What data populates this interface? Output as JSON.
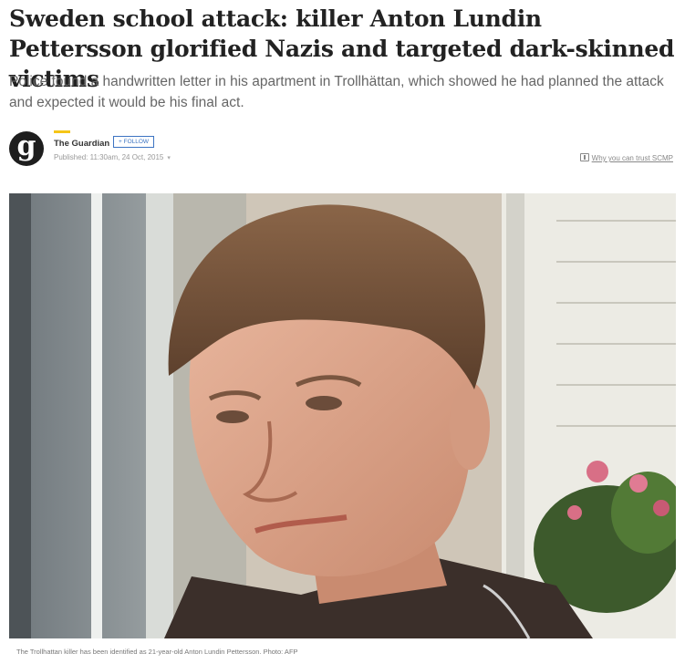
{
  "article": {
    "headline": "Sweden school attack: killer Anton Lundin Pettersson glorified Nazis and targeted dark-skinned victims",
    "standfirst": "Police found a handwritten letter in his apartment in Trollhättan, which showed he had planned the attack and expected it would be his final act."
  },
  "byline": {
    "avatar_letter": "g",
    "author": "The Guardian",
    "follow_label": "+ FOLLOW",
    "published": "Published: 11:30am, 24 Oct, 2015",
    "published_caret": "▾",
    "trust_link": "Why you can trust SCMP",
    "trust_icon": "trust-badge-icon"
  },
  "photo": {
    "caption": "The Trollhattan killer has been identified as 21-year-old Anton Lundin Pettersson. Photo: AFP"
  },
  "colors": {
    "accent": "#f5c518",
    "follow": "#3d74c2",
    "headline": "#222222",
    "standfirst": "#666666"
  }
}
